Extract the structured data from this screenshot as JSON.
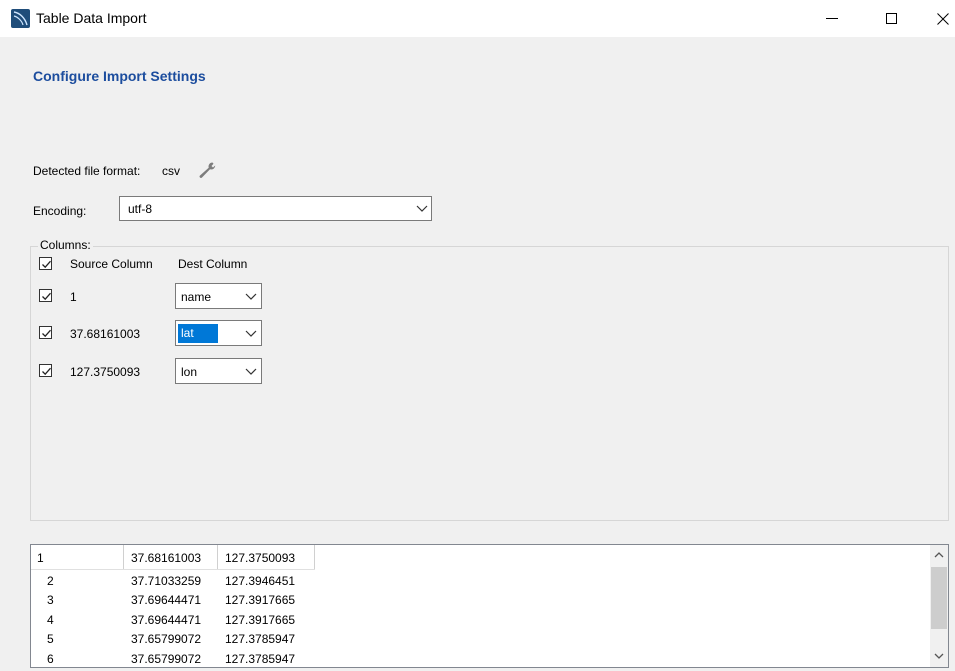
{
  "window": {
    "title": "Table Data Import",
    "controls": {
      "minimize": "—",
      "maximize": "☐",
      "close": "✕"
    }
  },
  "header": {
    "title": "Configure Import Settings"
  },
  "file_format": {
    "label": "Detected file format:",
    "value": "csv"
  },
  "encoding": {
    "label": "Encoding:",
    "value": "utf-8"
  },
  "columns_group": {
    "label": "Columns:",
    "header_source": "Source Column",
    "header_dest": "Dest Column",
    "rows": [
      {
        "source": "1",
        "dest": "name",
        "checked": true
      },
      {
        "source": "37.68161003",
        "dest": "lat",
        "checked": true
      },
      {
        "source": "127.3750093",
        "dest": "lon",
        "checked": true
      }
    ]
  },
  "preview": {
    "header": [
      "1",
      "37.68161003",
      "127.3750093"
    ],
    "rows": [
      [
        "2",
        "37.71033259",
        "127.3946451"
      ],
      [
        "3",
        "37.69644471",
        "127.3917665"
      ],
      [
        "4",
        "37.69644471",
        "127.3917665"
      ],
      [
        "5",
        "37.65799072",
        "127.3785947"
      ],
      [
        "6",
        "37.65799072",
        "127.3785947"
      ]
    ]
  },
  "colors": {
    "header_text": "#1c4d9e",
    "selection": "#0078d7"
  }
}
